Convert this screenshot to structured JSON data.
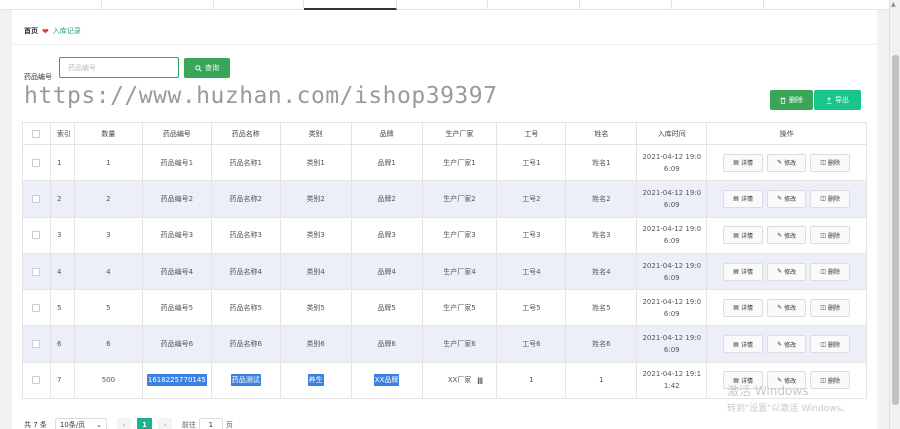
{
  "breadcrumb": {
    "home": "首页",
    "current": "入库记录"
  },
  "search": {
    "label": "药品编号",
    "placeholder": "药品编号",
    "button_label": "查询"
  },
  "watermark": "https://www.huzhan.com/ishop39397",
  "toolbar": {
    "delete_label": "删除",
    "export_label": "导出"
  },
  "table": {
    "headers": [
      "索引",
      "数量",
      "药品编号",
      "药品名称",
      "类别",
      "品牌",
      "生产厂家",
      "工号",
      "姓名",
      "入库时间",
      "操作"
    ],
    "rows": [
      {
        "index": "1",
        "qty": "1",
        "code": "药品编号1",
        "name": "药品名称1",
        "category": "类别1",
        "brand": "品牌1",
        "maker": "生产厂家1",
        "staff_no": "工号1",
        "staff_name": "姓名1",
        "time": "2021-04-12 19:06:09"
      },
      {
        "index": "2",
        "qty": "2",
        "code": "药品编号2",
        "name": "药品名称2",
        "category": "类别2",
        "brand": "品牌2",
        "maker": "生产厂家2",
        "staff_no": "工号2",
        "staff_name": "姓名2",
        "time": "2021-04-12 19:06:09"
      },
      {
        "index": "3",
        "qty": "3",
        "code": "药品编号3",
        "name": "药品名称3",
        "category": "类别3",
        "brand": "品牌3",
        "maker": "生产厂家3",
        "staff_no": "工号3",
        "staff_name": "姓名3",
        "time": "2021-04-12 19:06:09"
      },
      {
        "index": "4",
        "qty": "4",
        "code": "药品编号4",
        "name": "药品名称4",
        "category": "类别4",
        "brand": "品牌4",
        "maker": "生产厂家4",
        "staff_no": "工号4",
        "staff_name": "姓名4",
        "time": "2021-04-12 19:06:09"
      },
      {
        "index": "5",
        "qty": "5",
        "code": "药品编号5",
        "name": "药品名称5",
        "category": "类别5",
        "brand": "品牌5",
        "maker": "生产厂家5",
        "staff_no": "工号5",
        "staff_name": "姓名5",
        "time": "2021-04-12 19:06:09"
      },
      {
        "index": "6",
        "qty": "6",
        "code": "药品编号6",
        "name": "药品名称6",
        "category": "类别6",
        "brand": "品牌6",
        "maker": "生产厂家6",
        "staff_no": "工号6",
        "staff_name": "姓名6",
        "time": "2021-04-12 19:06:09"
      },
      {
        "index": "7",
        "qty": "500",
        "code": "1618225770145",
        "name": "药品测试",
        "category": "养生",
        "brand": "XX品牌",
        "maker": "XX厂家",
        "staff_no": "1",
        "staff_name": "1",
        "time": "2021-04-12 19:11:42"
      }
    ],
    "actions": {
      "detail": "详情",
      "edit": "修改",
      "delete": "删除"
    }
  },
  "pagination": {
    "total": "共 7 条",
    "page_size": "10条/页",
    "current_page": "1",
    "goto_label": "前往",
    "goto_value": "1",
    "page_suffix": "页"
  },
  "activation": {
    "title": "激活 Windows",
    "subtitle": "转到\"设置\"以激活 Windows。"
  },
  "colors": {
    "primary_green": "#3aa65a",
    "export_teal": "#19c48d",
    "page_active": "#19b48c",
    "highlight_blue": "#3d82e0",
    "row_stripe": "#eceef8"
  },
  "icons": {
    "breadcrumb_separator": "heart-icon",
    "search_button": "search-icon",
    "delete": "trash-icon",
    "export": "export-icon",
    "detail": "document-icon",
    "edit": "pencil-icon"
  }
}
